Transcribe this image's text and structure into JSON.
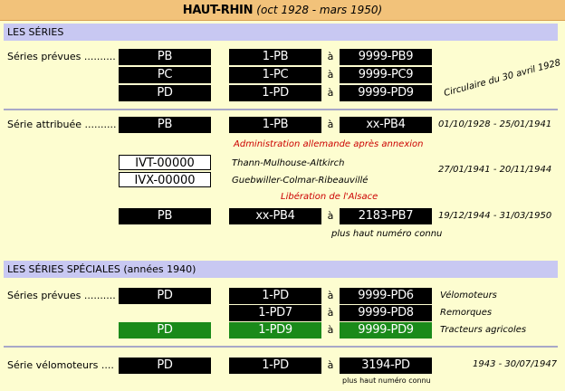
{
  "header": {
    "title": "HAUT-RHIN",
    "subtitle": "(oct 1928 - mars 1950)"
  },
  "sections": {
    "series": "LES SÉRIES",
    "special": "LES SÉRIES SPÉCIALES (années 1940)"
  },
  "a": "à",
  "prevues": {
    "label": "Séries prévues ..........",
    "rows": [
      {
        "code": "PB",
        "from": "1-PB",
        "to": "9999-PB9"
      },
      {
        "code": "PC",
        "from": "1-PC",
        "to": "9999-PC9"
      },
      {
        "code": "PD",
        "from": "1-PD",
        "to": "9999-PD9"
      }
    ],
    "note": "Circulaire du 30 avril 1928"
  },
  "attribuee": {
    "label": "Série attribuée ..........",
    "row1": {
      "code": "PB",
      "from": "1-PB",
      "to": "xx-PB4",
      "dates": "01/10/1928 - 25/01/1941"
    },
    "annex": "Administration allemande après annexion",
    "german": [
      {
        "plate": "IVT-00000",
        "area": "Thann-Mulhouse-Altkirch"
      },
      {
        "plate": "IVX-00000",
        "area": "Guebwiller-Colmar-Ribeauvillé"
      }
    ],
    "german_dates": "27/01/1941 - 20/11/1944",
    "liberation": "Libération de l'Alsace",
    "row2": {
      "code": "PB",
      "from": "xx-PB4",
      "to": "2183-PB7",
      "dates": "19/12/1944 - 31/03/1950"
    },
    "max_note": "plus haut numéro connu"
  },
  "special_prevues": {
    "label": "Séries prévues ..........",
    "rows": [
      {
        "code": "PD",
        "from": "1-PD",
        "to": "9999-PD6",
        "use": "Vélomoteurs",
        "green": false
      },
      {
        "code": "",
        "from": "1-PD7",
        "to": "9999-PD8",
        "use": "Remorques",
        "green": false
      },
      {
        "code": "PD",
        "from": "1-PD9",
        "to": "9999-PD9",
        "use": "Tracteurs agricoles",
        "green": true
      }
    ]
  },
  "velomoteurs": {
    "label": "Série vélomoteurs ....",
    "code": "PD",
    "from": "1-PD",
    "to": "3194-PD",
    "dates": "1943 - 30/07/1947",
    "max_note": "plus haut numéro connu"
  },
  "colors": {
    "background": "#fdfdd0",
    "title": "#f2c27a",
    "section": "#c8c8f2",
    "plate": "#000000",
    "green_plate": "#1a8a1a",
    "red_text": "#cc0000"
  }
}
